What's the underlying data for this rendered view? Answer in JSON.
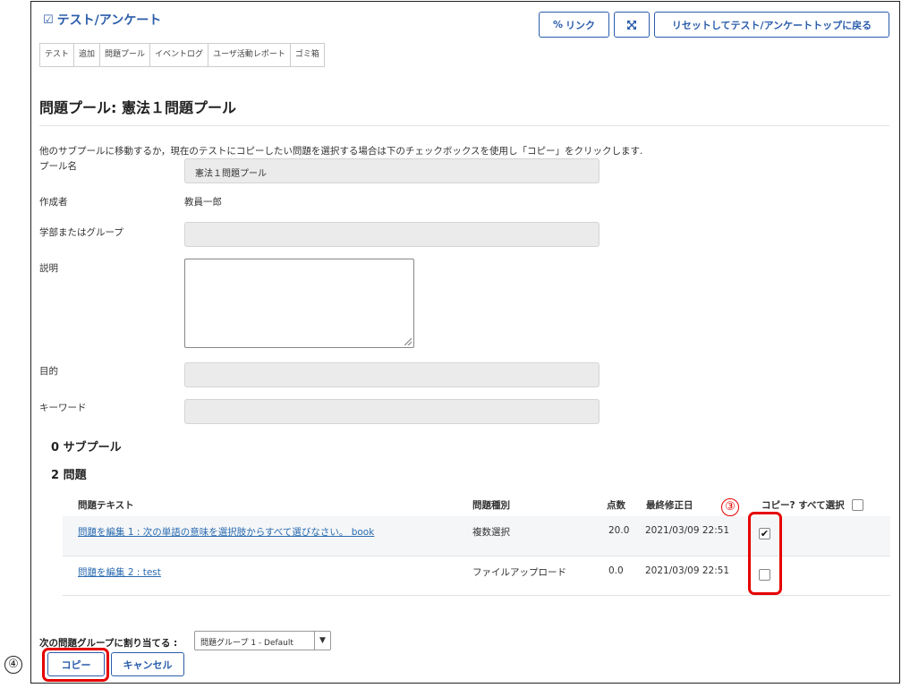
{
  "header": {
    "title": "テスト/アンケート",
    "link_button": "リンク",
    "reset_button": "リセットしてテスト/アンケートトップに戻る"
  },
  "tabs": [
    "テスト",
    "追加",
    "問題プール",
    "イベントログ",
    "ユーザ活動レポート",
    "ゴミ箱"
  ],
  "page_title": "問題プール: 憲法１問題プール",
  "instructions": "他のサブプールに移動するか，現在のテストにコピーしたい問題を選択する場合は下のチェックボックスを使用し「コピー」をクリックします.",
  "form": {
    "pool_name_label": "プール名",
    "pool_name_value": "憲法１問題プール",
    "creator_label": "作成者",
    "creator_value": "教員一郎",
    "department_label": "学部またはグループ",
    "description_label": "説明",
    "objective_label": "目的",
    "keywords_label": "キーワード"
  },
  "subpools_heading": "0 サブプール",
  "questions_heading": "2 問題",
  "table": {
    "headers": {
      "text": "問題テキスト",
      "type": "問題種別",
      "points": "点数",
      "modified": "最終修正日",
      "copy": "コピー? すべて選択"
    },
    "rows": [
      {
        "text": "問題を編集 1 : 次の単語の意味を選択肢からすべて選びなさい。 book",
        "type": "複数選択",
        "points": "20.0",
        "modified": "2021/03/09 22:51",
        "checked": true
      },
      {
        "text": "問題を編集 2 : test",
        "type": "ファイルアップロード",
        "points": "0.0",
        "modified": "2021/03/09 22:51",
        "checked": false
      }
    ]
  },
  "assign": {
    "label": "次の問題グループに割り当てる :",
    "selected": "問題グループ 1 - Default"
  },
  "buttons": {
    "copy": "コピー",
    "cancel": "キャンセル"
  },
  "annotations": {
    "step3": "③",
    "step4": "④"
  },
  "colors": {
    "accent": "#2a5caa",
    "link": "#2a6bb0",
    "highlight": "#e60000"
  },
  "icons": {
    "title": "checkbox-icon",
    "link": "link-icon",
    "fullscreen": "expand-icon",
    "select": "caret-down-icon"
  }
}
